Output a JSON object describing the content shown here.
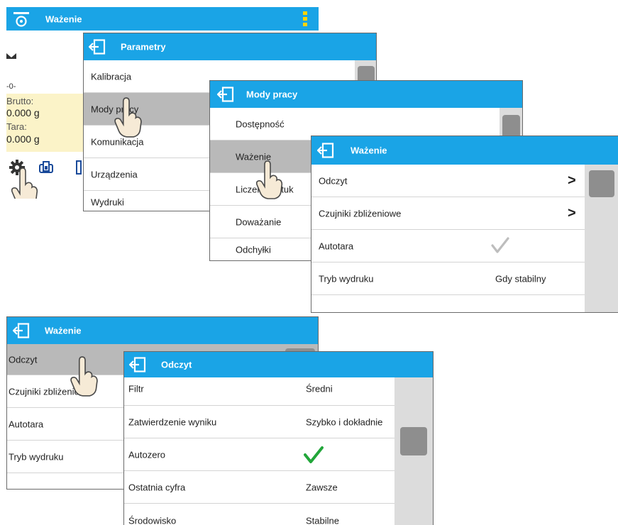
{
  "main_screen": {
    "title": "Ważenie",
    "zero_indicator": "-0-",
    "brutto_label": "Brutto:",
    "brutto_value": "0.000 g",
    "tara_label": "Tara:",
    "tara_value": "0.000 g"
  },
  "parametry": {
    "title": "Parametry",
    "items": [
      "Kalibracja",
      "Mody pracy",
      "Komunikacja",
      "Urządzenia",
      "Wydruki"
    ]
  },
  "mody_pracy": {
    "title": "Mody pracy",
    "items": [
      "Dostępność",
      "Ważenie",
      "Liczenie sztuk",
      "Doważanie",
      "Odchyłki"
    ]
  },
  "wazenie_menu": {
    "title": "Ważenie",
    "items": [
      {
        "label": "Odczyt",
        "value": ""
      },
      {
        "label": "Czujniki zbliżeniowe",
        "value": ""
      },
      {
        "label": "Autotara",
        "value": ""
      },
      {
        "label": "Tryb wydruku",
        "value": "Gdy stabilny"
      }
    ]
  },
  "wazenie_menu_2": {
    "title": "Ważenie",
    "items": [
      "Odczyt",
      "Czujniki zbliżeniowe",
      "Autotara",
      "Tryb wydruku"
    ]
  },
  "odczyt": {
    "title": "Odczyt",
    "items": [
      {
        "label": "Filtr",
        "value": "Średni"
      },
      {
        "label": "Zatwierdzenie wyniku",
        "value": "Szybko i dokładnie"
      },
      {
        "label": "Autozero",
        "value": ""
      },
      {
        "label": "Ostatnia cyfra",
        "value": "Zawsze"
      },
      {
        "label": "Środowisko",
        "value": "Stabilne"
      }
    ]
  },
  "colors": {
    "header": "#1aa4e6",
    "selected_row": "#b9b9b9",
    "check_green": "#22a63a",
    "check_grey": "#bdbdbd"
  }
}
